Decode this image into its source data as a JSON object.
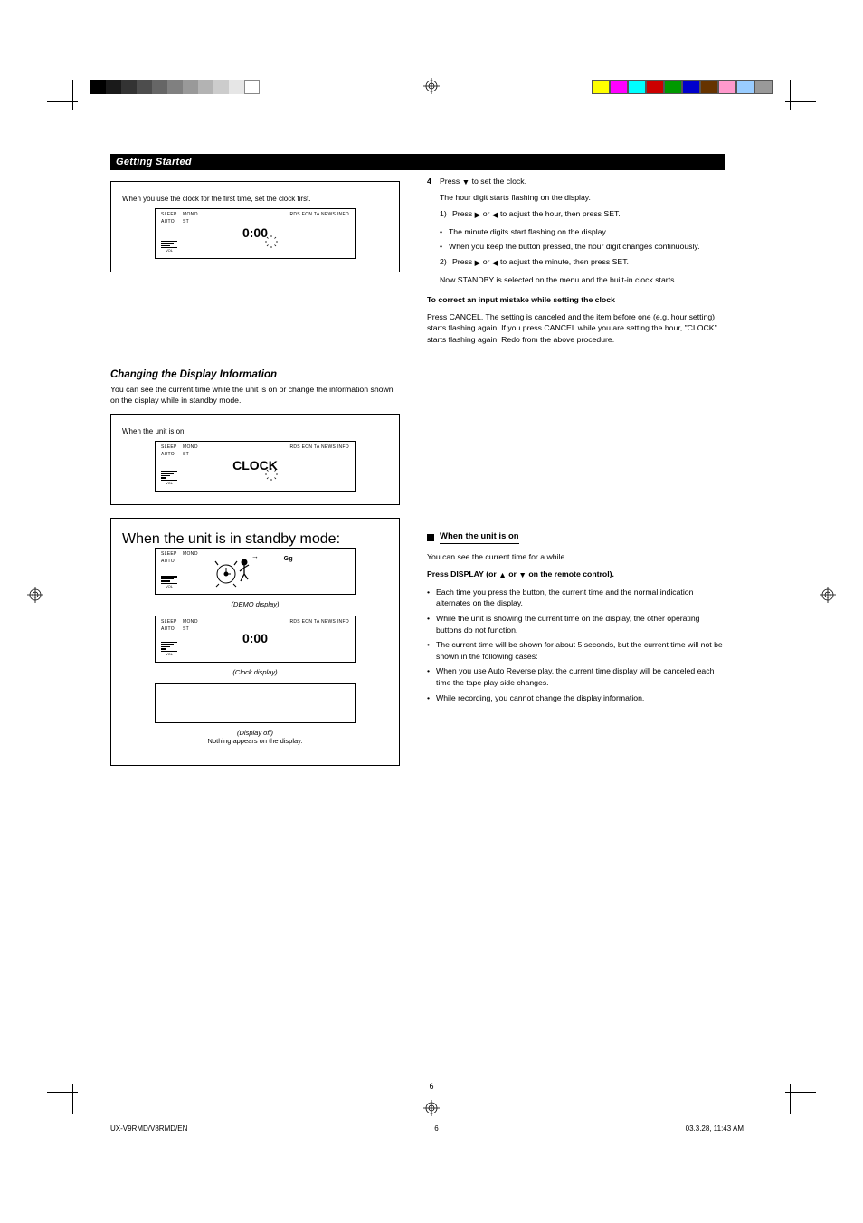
{
  "section_bar": "Getting Started",
  "fig1": {
    "caption": "When you use the clock for the first time, set the clock first.",
    "sleep": "SLEEP",
    "auto": "AUTO",
    "mono": "MONO",
    "st": "ST",
    "rds": "RDS EON TA NEWS INFO",
    "vol": "VOL",
    "big": "0:00"
  },
  "steps_a": {
    "s4": {
      "num": "4",
      "txt_before": "Press ",
      "arrow": "▼",
      "txt_after": " to set the clock."
    },
    "s4_cont": "The hour digit starts flashing on the display.",
    "s5_1": {
      "num": "1)",
      "txt_before": "Press ",
      "right": "▶",
      "or": " or ",
      "left": "◀",
      "txt_after": " to adjust the hour, then press SET."
    },
    "b1": "The minute digits start flashing on the display.",
    "b2": "When you keep the button pressed, the hour digit changes continuously.",
    "s5_2": {
      "num": "2)",
      "txt_before": "Press ",
      "right": "▶",
      "or": " or ",
      "left": "◀",
      "txt_after": " to adjust the minute, then press SET."
    },
    "s5_2_cont": "Now STANDBY is selected on the menu and the built-in clock starts.",
    "closing": "To correct an input mistake while setting the clock",
    "closing_body": "Press CANCEL. The setting is canceled and the item before one (e.g. hour setting) starts flashing again. If you press CANCEL while you are setting the hour, \"CLOCK\" starts flashing again. Redo from the above procedure."
  },
  "sec2": {
    "title": "Changing the Display Information",
    "intro": "You can see the current time while the unit is on or change the information shown on the display while in standby mode.",
    "fig_caption": "When the unit is on:"
  },
  "fig2": {
    "sleep": "SLEEP",
    "auto": "AUTO",
    "mono": "MONO",
    "st": "ST",
    "rds": "RDS EON TA NEWS INFO",
    "vol": "VOL",
    "big": "CLOCK"
  },
  "multifig": {
    "caption": "When the unit is in standby mode:",
    "lab1": "(DEMO display)",
    "lab2": "(Clock display)",
    "lab3_a": "(Display off)",
    "lab3_b": "Nothing appears on the display.",
    "walk_dest": "Gg"
  },
  "right2": {
    "subhead": "When the unit is on",
    "intro": "You can see the current time for a while.",
    "step": {
      "txt_before": "Press DISPLAY (or ",
      "up": "▲",
      "or": " or ",
      "down": "▼",
      "txt_after": " on the remote control)."
    },
    "bullets": [
      "Each time you press the button, the current time and the normal indication alternates on the display.",
      "While the unit is showing the current time on the display, the other operating buttons do not function.",
      "The current time will be shown for about 5 seconds, but the current time will not be shown in the following cases:",
      "When you use Auto Reverse play, the current time display will be canceled each time the tape play side changes.",
      "While recording, you cannot change the display information."
    ]
  },
  "pagenum": "6",
  "slug": {
    "left": "UX-V9RMD/V8RMD/EN",
    "right": "03.3.28, 11:43 AM",
    "mid": "6"
  },
  "graybar_shades": [
    "#000",
    "#1a1a1a",
    "#333",
    "#4d4d4d",
    "#666",
    "#808080",
    "#999",
    "#b3b3b3",
    "#ccc",
    "#e6e6e6",
    "#fff"
  ],
  "colorbar": [
    "#ffff00",
    "#ff00ff",
    "#00ffff",
    "#cc0000",
    "#009900",
    "#0000cc",
    "#663300",
    "#ff99cc",
    "#99ccff",
    "#999999"
  ]
}
